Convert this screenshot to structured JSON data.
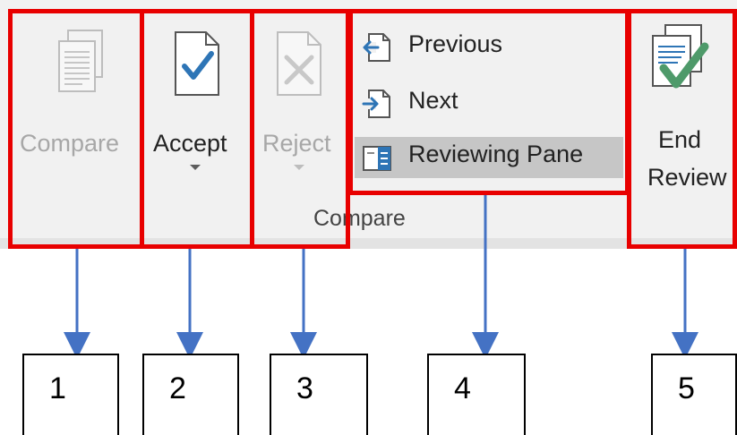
{
  "ribbon": {
    "compare_button": {
      "label": "Compare",
      "icon": "compare-documents-icon",
      "disabled": true
    },
    "accept_button": {
      "label": "Accept",
      "icon": "accept-check-icon",
      "disabled": false
    },
    "reject_button": {
      "label": "Reject",
      "icon": "reject-x-icon",
      "disabled": true
    },
    "navigation": [
      {
        "label": "Previous",
        "icon": "previous-arrow-icon"
      },
      {
        "label": "Next",
        "icon": "next-arrow-icon"
      },
      {
        "label": "Reviewing Pane",
        "icon": "reviewing-pane-icon",
        "active": true
      }
    ],
    "end_review_button": {
      "label_line1": "End",
      "label_line2": "Review",
      "icon": "end-review-icon"
    },
    "group_label": "Compare"
  },
  "callouts": [
    "1",
    "2",
    "3",
    "4",
    "5"
  ],
  "colors": {
    "highlight_border": "#e80000",
    "arrow": "#4472c4",
    "check": "#2e75b6",
    "end_review_check": "#4e9a6a"
  }
}
